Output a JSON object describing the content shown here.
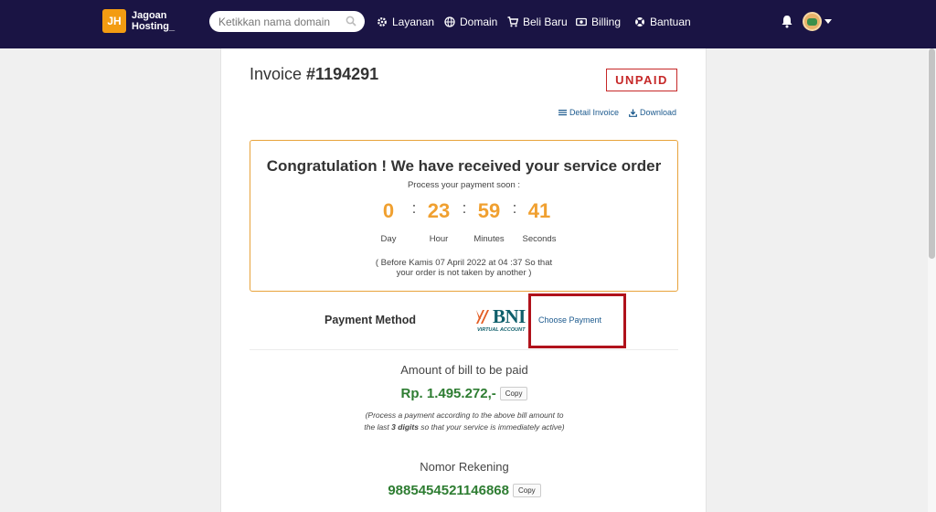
{
  "brand": {
    "logo_mark": "JH",
    "name_line1": "Jagoan",
    "name_line2": "Hosting_"
  },
  "search": {
    "placeholder": "Ketikkan nama domain",
    "icon": "search-icon"
  },
  "nav": {
    "items": [
      {
        "label": "Layanan",
        "icon": "gears-icon"
      },
      {
        "label": "Domain",
        "icon": "globe-icon"
      },
      {
        "label": "Beli Baru",
        "icon": "cart-icon"
      },
      {
        "label": "Billing",
        "icon": "money-icon"
      },
      {
        "label": "Bantuan",
        "icon": "lifebuoy-icon"
      }
    ],
    "notification_icon": "bell-icon",
    "avatar_icon": "avatar-icon"
  },
  "invoice": {
    "title_prefix": "Invoice ",
    "number": "#1194291",
    "status": "UNPAID",
    "detail_link": "Detail Invoice",
    "download_link": "Download"
  },
  "countdown": {
    "headline": "Congratulation ! We have received your service order",
    "subtext": "Process your payment soon :",
    "day": "0",
    "hour": "23",
    "minutes": "59",
    "seconds": "41",
    "day_label": "Day",
    "hour_label": "Hour",
    "minutes_label": "Minutes",
    "seconds_label": "Seconds",
    "deadline_line1": "( Before Kamis 07 April 2022 at 04 :37 So that",
    "deadline_line2": "your order is not taken by another )"
  },
  "payment": {
    "label": "Payment Method",
    "bank_name": "BNI",
    "bank_sub": "VIRTUAL ACCOUNT",
    "choose_label": "Choose Payment"
  },
  "amount": {
    "label": "Amount of bill to be paid",
    "value": "Rp. 1.495.272,-",
    "copy_label": "Copy",
    "note_before": "(Process a payment according to the above bill amount to the last ",
    "note_bold": "3 digits",
    "note_after": " so that your service is immediately active)"
  },
  "account": {
    "label": "Nomor Rekening",
    "value": "9885454521146868",
    "copy_label": "Copy"
  },
  "colors": {
    "navbar": "#1a1444",
    "accent_orange": "#f0a030",
    "unpaid_red": "#c62828",
    "amount_green": "#2e7d32",
    "link_blue": "#1c5a8e"
  }
}
